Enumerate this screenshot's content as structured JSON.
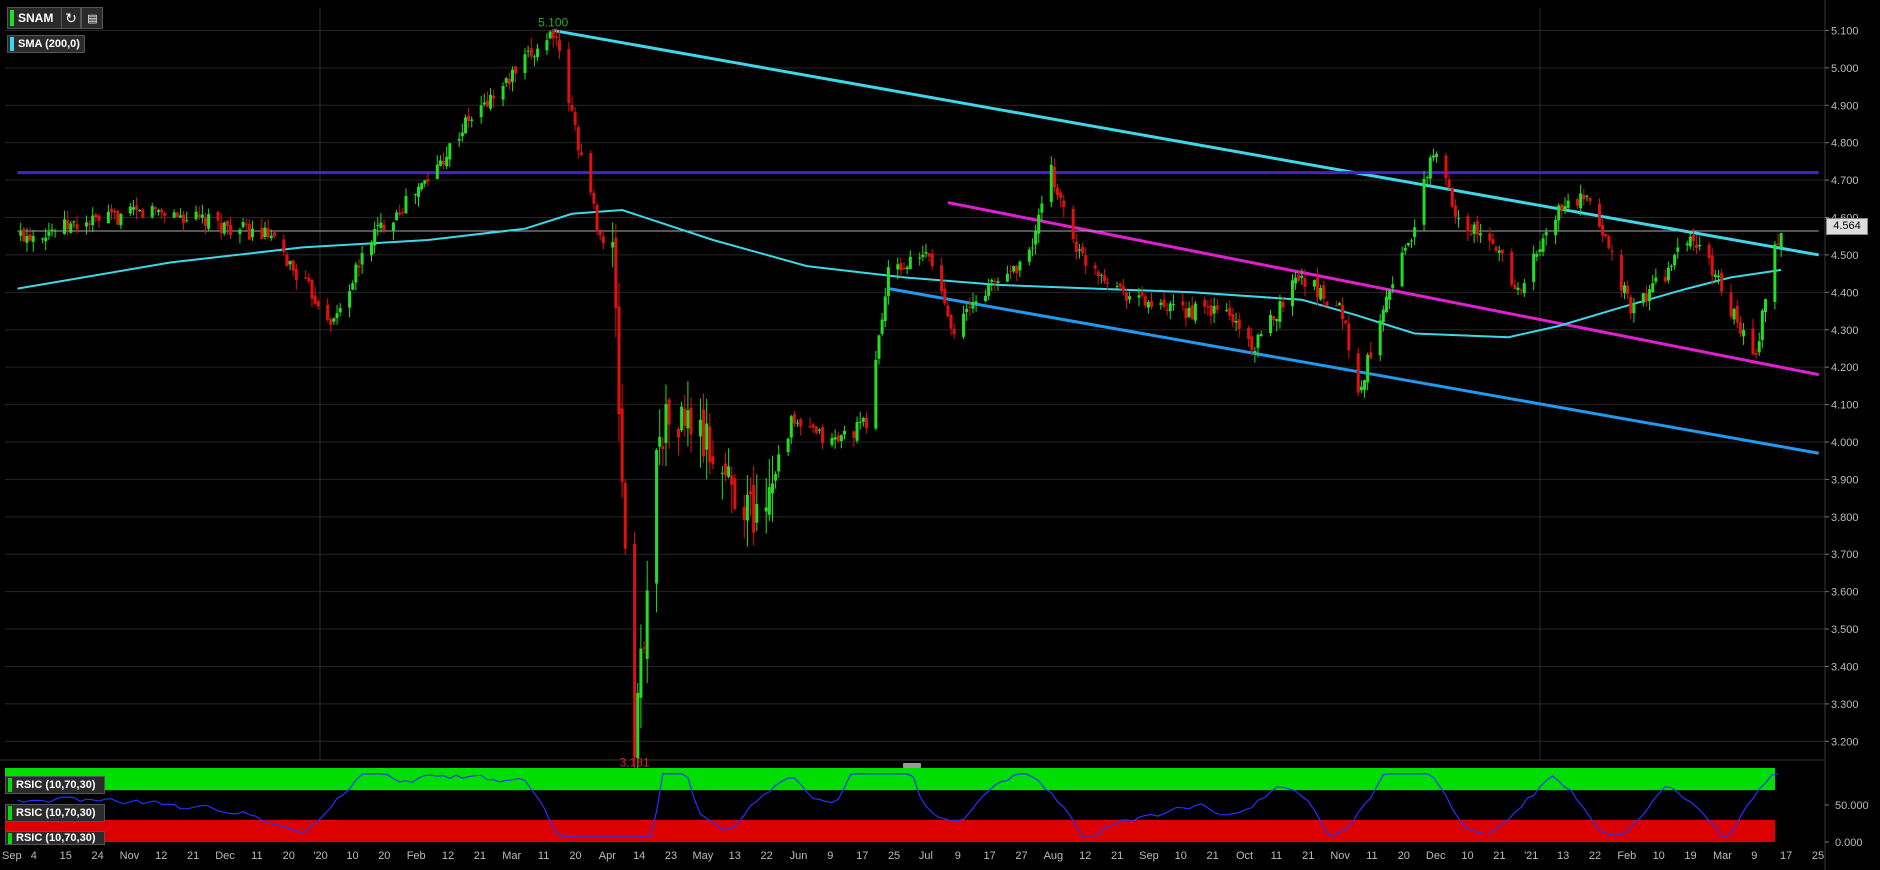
{
  "toolbar": {
    "symbol": "SNAM",
    "symbol_color": "#22dd22",
    "refresh_icon": "refresh-icon",
    "settings_icon": "chart-settings-icon"
  },
  "indicator_legend": {
    "label": "SMA (200,0)",
    "color": "#3dd8e8"
  },
  "rsi_panel": {
    "labels": [
      "RSIC (10,70,30)",
      "RSIC (10,70,30)",
      "RSIC (10,70,30)"
    ],
    "overbought_color": "#00dd00",
    "oversold_color": "#dd0000",
    "line_color": "#2233ff",
    "axis_labels": [
      "50.000",
      "0.000"
    ]
  },
  "chart_data": {
    "type": "candlestick",
    "symbol": "SNAM",
    "price_axis": {
      "ylim": [
        3.15,
        5.16
      ],
      "ticks": [
        "5.100",
        "5.000",
        "4.900",
        "4.800",
        "4.700",
        "4.600",
        "4.500",
        "4.400",
        "4.300",
        "4.200",
        "4.100",
        "4.000",
        "3.900",
        "3.800",
        "3.700",
        "3.600",
        "3.500",
        "3.400",
        "3.300",
        "3.200"
      ]
    },
    "current_price": "4.564",
    "annotations": [
      {
        "text": "5.100",
        "kind": "high",
        "color": "#22aa22"
      },
      {
        "text": "3.181",
        "kind": "low",
        "color": "#dd2222"
      }
    ],
    "x_tick_labels": [
      "Sep",
      "4",
      "15",
      "24",
      "Nov",
      "12",
      "21",
      "Dec",
      "11",
      "20",
      "'20",
      "10",
      "20",
      "Feb",
      "12",
      "21",
      "Mar",
      "11",
      "20",
      "Apr",
      "14",
      "23",
      "May",
      "13",
      "22",
      "Jun",
      "9",
      "17",
      "25",
      "Jul",
      "9",
      "17",
      "27",
      "Aug",
      "12",
      "21",
      "Sep",
      "10",
      "21",
      "Oct",
      "11",
      "21",
      "Nov",
      "11",
      "20",
      "Dec",
      "10",
      "21",
      "'21",
      "13",
      "22",
      "Feb",
      "10",
      "19",
      "Mar",
      "9",
      "17",
      "25"
    ],
    "key_prices": [
      {
        "date": "2019-09-01",
        "price": 4.55
      },
      {
        "date": "2019-10-15",
        "price": 4.62
      },
      {
        "date": "2019-11-20",
        "price": 4.55
      },
      {
        "date": "2019-12-11",
        "price": 4.32
      },
      {
        "date": "2019-12-23",
        "price": 4.55
      },
      {
        "date": "2020-01-10",
        "price": 4.7
      },
      {
        "date": "2020-01-22",
        "price": 4.85
      },
      {
        "date": "2020-02-03",
        "price": 4.95
      },
      {
        "date": "2020-02-19",
        "price": 5.1
      },
      {
        "date": "2020-02-27",
        "price": 4.8
      },
      {
        "date": "2020-03-05",
        "price": 4.55
      },
      {
        "date": "2020-03-09",
        "price": 4.5
      },
      {
        "date": "2020-03-12",
        "price": 3.9
      },
      {
        "date": "2020-03-16",
        "price": 3.181
      },
      {
        "date": "2020-03-24",
        "price": 4.05
      },
      {
        "date": "2020-04-03",
        "price": 4.05
      },
      {
        "date": "2020-04-15",
        "price": 3.9
      },
      {
        "date": "2020-04-24",
        "price": 3.8
      },
      {
        "date": "2020-05-05",
        "price": 4.05
      },
      {
        "date": "2020-05-18",
        "price": 4.0
      },
      {
        "date": "2020-05-29",
        "price": 4.05
      },
      {
        "date": "2020-06-05",
        "price": 4.45
      },
      {
        "date": "2020-06-18",
        "price": 4.5
      },
      {
        "date": "2020-06-26",
        "price": 4.3
      },
      {
        "date": "2020-07-05",
        "price": 4.4
      },
      {
        "date": "2020-07-20",
        "price": 4.5
      },
      {
        "date": "2020-07-27",
        "price": 4.72
      },
      {
        "date": "2020-08-05",
        "price": 4.5
      },
      {
        "date": "2020-08-20",
        "price": 4.4
      },
      {
        "date": "2020-09-01",
        "price": 4.35
      },
      {
        "date": "2020-09-21",
        "price": 4.35
      },
      {
        "date": "2020-09-30",
        "price": 4.25
      },
      {
        "date": "2020-10-14",
        "price": 4.45
      },
      {
        "date": "2020-10-28",
        "price": 4.35
      },
      {
        "date": "2020-11-02",
        "price": 4.12
      },
      {
        "date": "2020-11-11",
        "price": 4.4
      },
      {
        "date": "2020-11-19",
        "price": 4.55
      },
      {
        "date": "2020-11-26",
        "price": 4.78
      },
      {
        "date": "2020-12-04",
        "price": 4.6
      },
      {
        "date": "2020-12-18",
        "price": 4.5
      },
      {
        "date": "2020-12-23",
        "price": 4.4
      },
      {
        "date": "2021-01-05",
        "price": 4.62
      },
      {
        "date": "2021-01-13",
        "price": 4.65
      },
      {
        "date": "2021-01-20",
        "price": 4.55
      },
      {
        "date": "2021-01-28",
        "price": 4.35
      },
      {
        "date": "2021-02-08",
        "price": 4.45
      },
      {
        "date": "2021-02-16",
        "price": 4.55
      },
      {
        "date": "2021-02-24",
        "price": 4.45
      },
      {
        "date": "2021-03-04",
        "price": 4.3
      },
      {
        "date": "2021-03-09",
        "price": 4.22
      },
      {
        "date": "2021-03-13",
        "price": 4.45
      },
      {
        "date": "2021-03-17",
        "price": 4.564
      }
    ],
    "sma_200": [
      {
        "date": "2019-09-01",
        "price": 4.41
      },
      {
        "date": "2019-10-20",
        "price": 4.48
      },
      {
        "date": "2019-12-01",
        "price": 4.52
      },
      {
        "date": "2020-01-10",
        "price": 4.54
      },
      {
        "date": "2020-02-10",
        "price": 4.57
      },
      {
        "date": "2020-02-25",
        "price": 4.61
      },
      {
        "date": "2020-03-12",
        "price": 4.62
      },
      {
        "date": "2020-04-10",
        "price": 4.54
      },
      {
        "date": "2020-05-10",
        "price": 4.47
      },
      {
        "date": "2020-06-10",
        "price": 4.44
      },
      {
        "date": "2020-07-10",
        "price": 4.42
      },
      {
        "date": "2020-08-10",
        "price": 4.41
      },
      {
        "date": "2020-09-10",
        "price": 4.4
      },
      {
        "date": "2020-10-15",
        "price": 4.38
      },
      {
        "date": "2020-11-01",
        "price": 4.34
      },
      {
        "date": "2020-11-20",
        "price": 4.29
      },
      {
        "date": "2020-12-20",
        "price": 4.28
      },
      {
        "date": "2021-01-05",
        "price": 4.31
      },
      {
        "date": "2021-01-25",
        "price": 4.36
      },
      {
        "date": "2021-02-15",
        "price": 4.41
      },
      {
        "date": "2021-03-01",
        "price": 4.44
      },
      {
        "date": "2021-03-17",
        "price": 4.46
      }
    ],
    "trend_lines": [
      {
        "name": "resistance",
        "color": "#3dd8e8",
        "from": {
          "date": "2020-02-19",
          "price": 5.1
        },
        "to": {
          "date": "2021-03-29",
          "price": 4.5
        }
      },
      {
        "name": "horizontal",
        "color": "#4422cc",
        "from": {
          "date": "2019-09-01",
          "price": 4.72
        },
        "to": {
          "date": "2021-03-29",
          "price": 4.72
        }
      },
      {
        "name": "upper-channel",
        "color": "#e020d0",
        "from": {
          "date": "2020-06-24",
          "price": 4.64
        },
        "to": {
          "date": "2021-03-29",
          "price": 4.18
        }
      },
      {
        "name": "lower-channel",
        "color": "#2299ee",
        "from": {
          "date": "2020-06-05",
          "price": 4.41
        },
        "to": {
          "date": "2021-03-29",
          "price": 3.97
        }
      },
      {
        "name": "current-price",
        "color": "#aaaaaa",
        "from": {
          "date": "2019-09-01",
          "price": 4.564
        },
        "to": {
          "date": "2021-03-29",
          "price": 4.564
        }
      }
    ],
    "rsi": {
      "params": "10,70,30",
      "ylim": [
        0,
        100
      ],
      "ticks": [
        "50.000",
        "0.000"
      ]
    },
    "grid": true
  }
}
